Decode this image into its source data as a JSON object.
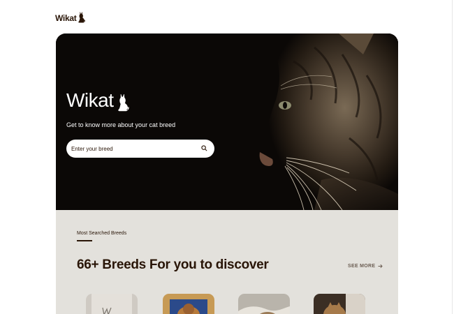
{
  "brand": {
    "name": "Wikat"
  },
  "hero": {
    "title": "Wikat",
    "subtitle": "Get to know more about your cat breed",
    "search": {
      "placeholder": "Enter your breed"
    }
  },
  "breeds_section": {
    "eyebrow": "Most Searched Breeds",
    "headline": "66+ Breeds For you to discover",
    "see_more": "SEE MORE",
    "thumbnails": [
      "breed-1",
      "breed-2",
      "breed-3",
      "breed-4"
    ]
  },
  "colors": {
    "primary_text": "#291507",
    "hero_bg": "#0b0806",
    "section_bg": "#e3e1dc"
  },
  "icons": [
    "cat-icon",
    "search-icon",
    "arrow-right-icon"
  ]
}
